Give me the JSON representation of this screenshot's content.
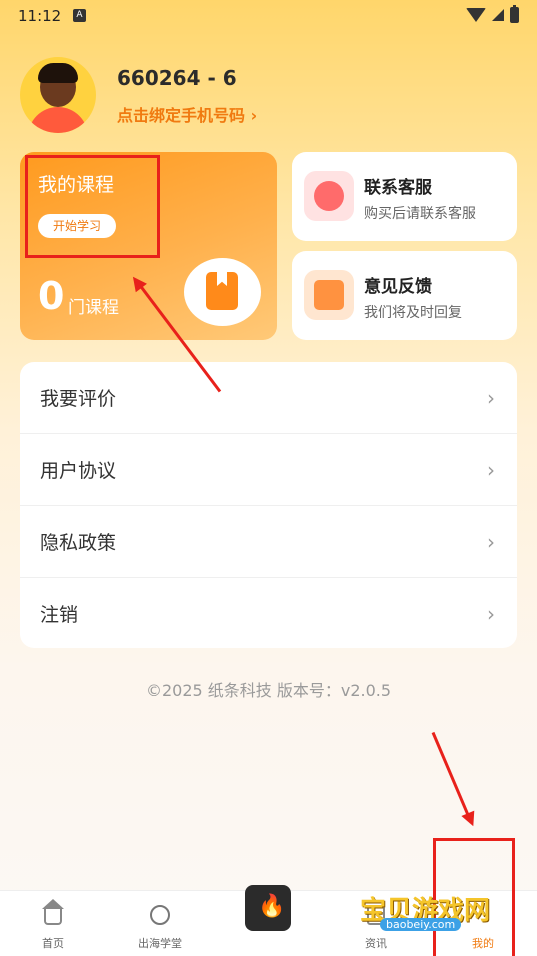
{
  "status_bar": {
    "time": "11:12",
    "a_icon": "A"
  },
  "profile": {
    "username": "660264 - 6",
    "bind_phone": "点击绑定手机号码 ›"
  },
  "course_card": {
    "title": "我的课程",
    "start_button": "开始学习",
    "count": "0",
    "unit": "门课程"
  },
  "services": [
    {
      "title": "联系客服",
      "subtitle": "购买后请联系客服",
      "icon": "headset-icon"
    },
    {
      "title": "意见反馈",
      "subtitle": "我们将及时回复",
      "icon": "mail-icon"
    }
  ],
  "menu": [
    {
      "label": "我要评价",
      "chevron": "›"
    },
    {
      "label": "用户协议",
      "chevron": "›"
    },
    {
      "label": "隐私政策",
      "chevron": "›"
    },
    {
      "label": "注销",
      "chevron": "›"
    }
  ],
  "copyright": "©2025 纸条科技 版本号：v2.0.5",
  "tabbar": {
    "home": "首页",
    "study": "出海学堂",
    "fire_glyph": "🔥",
    "news": "资讯",
    "me": "我的"
  },
  "watermark": {
    "title": "宝贝游戏网",
    "url": "baobeiy.com"
  },
  "colors": {
    "accent": "#F07A10",
    "annotation": "#E8211B",
    "course_card": "#FF9A1E"
  }
}
